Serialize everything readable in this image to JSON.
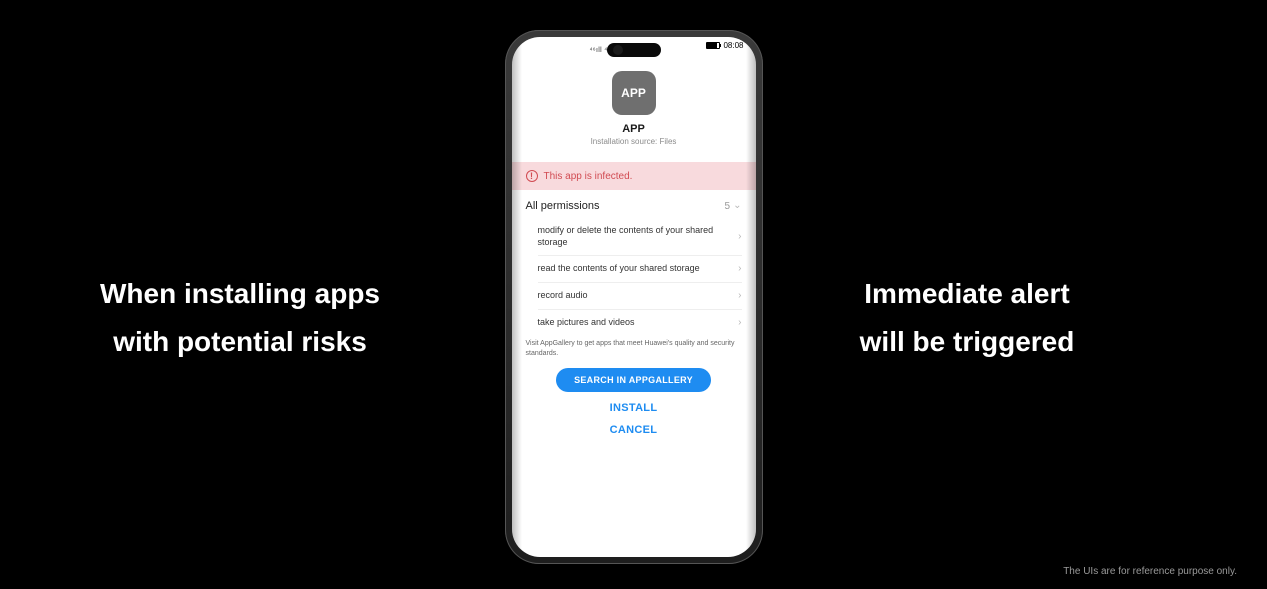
{
  "captions": {
    "left": "When installing apps\nwith potential risks",
    "right": "Immediate alert\nwill be triggered"
  },
  "disclaimer": "The UIs are for reference purpose only.",
  "status": {
    "signal_text": "⁴⁶ıll ⁴⁶ıll ᯤ",
    "time": "08:08"
  },
  "app": {
    "icon_label": "APP",
    "name": "APP",
    "source": "Installation source: Files"
  },
  "warning": {
    "icon_glyph": "!",
    "text": "This app is infected."
  },
  "permissions": {
    "header": "All permissions",
    "count": "5",
    "items": [
      "modify or delete the contents of your shared storage",
      "read the contents of your shared storage",
      "record audio",
      "take pictures and videos"
    ]
  },
  "note": "Visit AppGallery to get apps that meet Huawei's quality and security standards.",
  "buttons": {
    "search": "SEARCH IN APPGALLERY",
    "install": "INSTALL",
    "cancel": "CANCEL"
  }
}
